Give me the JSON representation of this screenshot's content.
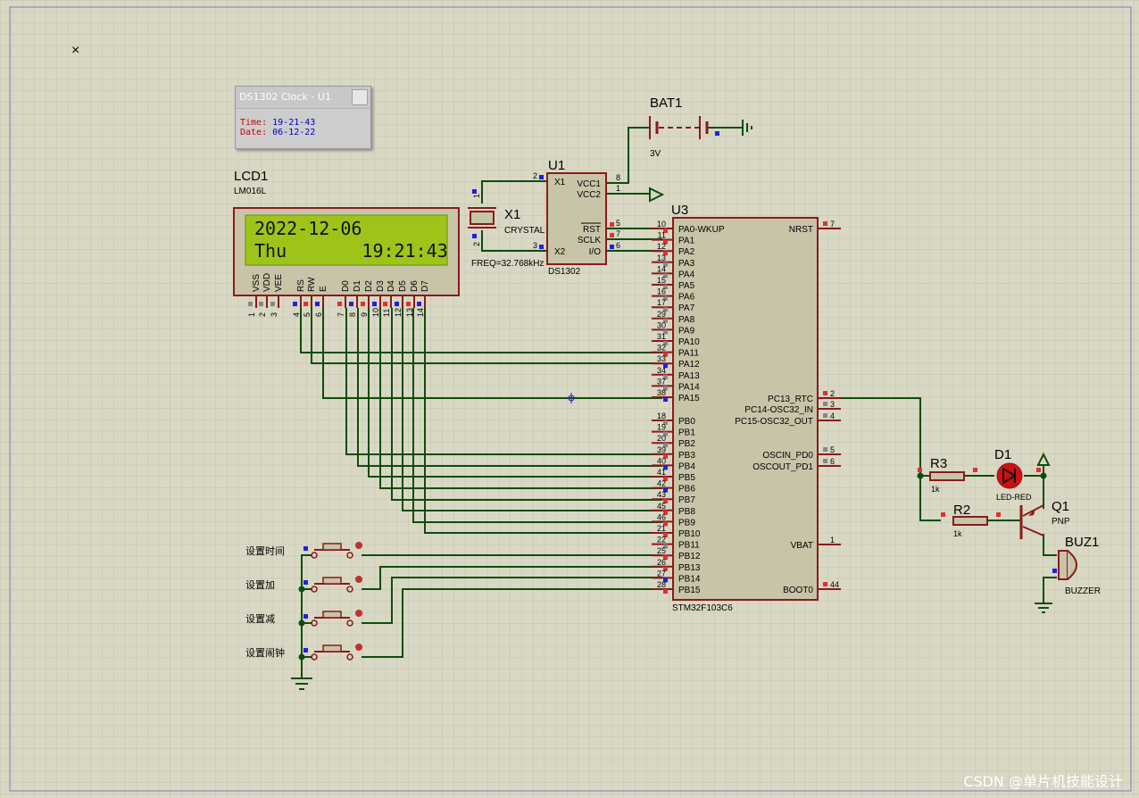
{
  "close_glyph": "×",
  "popup": {
    "title": "DS1302 Clock - U1",
    "time_label": "Time:",
    "time_value": "19-21-43",
    "date_label": "Date:",
    "date_value": "06-12-22"
  },
  "lcd": {
    "ref": "LCD1",
    "model": "LM016L",
    "line1": "2022-12-06",
    "line2": "Thu       19:21:43",
    "pin_names": [
      "VSS",
      "VDD",
      "VEE",
      "RS",
      "RW",
      "E",
      "D0",
      "D1",
      "D2",
      "D3",
      "D4",
      "D5",
      "D6",
      "D7"
    ],
    "pin_numbers": [
      "1",
      "2",
      "3",
      "4",
      "5",
      "6",
      "7",
      "8",
      "9",
      "10",
      "11",
      "12",
      "13",
      "14"
    ]
  },
  "u1": {
    "ref": "U1",
    "model": "DS1302",
    "left_pins": [
      {
        "name": "X1",
        "num": "2"
      },
      {
        "name": "X2",
        "num": "3"
      }
    ],
    "right_pins": [
      {
        "name": "VCC1",
        "num": "8"
      },
      {
        "name": "VCC2",
        "num": "1"
      },
      {
        "name": "RST",
        "num": "5"
      },
      {
        "name": "SCLK",
        "num": "7"
      },
      {
        "name": "I/O",
        "num": "6"
      }
    ]
  },
  "crystal": {
    "ref": "X1",
    "type": "CRYSTAL",
    "freq": "FREQ=32.768kHz",
    "pin1": "1",
    "pin2": "2"
  },
  "battery": {
    "ref": "BAT1",
    "value": "3V"
  },
  "u3": {
    "ref": "U3",
    "model": "STM32F103C6",
    "left_pins": [
      {
        "name": "PA0-WKUP",
        "num": "10"
      },
      {
        "name": "PA1",
        "num": "11"
      },
      {
        "name": "PA2",
        "num": "12"
      },
      {
        "name": "PA3",
        "num": "13"
      },
      {
        "name": "PA4",
        "num": "14"
      },
      {
        "name": "PA5",
        "num": "15"
      },
      {
        "name": "PA6",
        "num": "16"
      },
      {
        "name": "PA7",
        "num": "17"
      },
      {
        "name": "PA8",
        "num": "29"
      },
      {
        "name": "PA9",
        "num": "30"
      },
      {
        "name": "PA10",
        "num": "31"
      },
      {
        "name": "PA11",
        "num": "32"
      },
      {
        "name": "PA12",
        "num": "33"
      },
      {
        "name": "PA13",
        "num": "34"
      },
      {
        "name": "PA14",
        "num": "37"
      },
      {
        "name": "PA15",
        "num": "38"
      },
      {
        "name": "PB0",
        "num": "18"
      },
      {
        "name": "PB1",
        "num": "19"
      },
      {
        "name": "PB2",
        "num": "20"
      },
      {
        "name": "PB3",
        "num": "39"
      },
      {
        "name": "PB4",
        "num": "40"
      },
      {
        "name": "PB5",
        "num": "41"
      },
      {
        "name": "PB6",
        "num": "42"
      },
      {
        "name": "PB7",
        "num": "43"
      },
      {
        "name": "PB8",
        "num": "45"
      },
      {
        "name": "PB9",
        "num": "46"
      },
      {
        "name": "PB10",
        "num": "21"
      },
      {
        "name": "PB11",
        "num": "22"
      },
      {
        "name": "PB12",
        "num": "25"
      },
      {
        "name": "PB13",
        "num": "26"
      },
      {
        "name": "PB14",
        "num": "27"
      },
      {
        "name": "PB15",
        "num": "28"
      }
    ],
    "right_pins": [
      {
        "name": "NRST",
        "num": "7"
      },
      {
        "name": "PC13_RTC",
        "num": "2"
      },
      {
        "name": "PC14-OSC32_IN",
        "num": "3"
      },
      {
        "name": "PC15-OSC32_OUT",
        "num": "4"
      },
      {
        "name": "OSCIN_PD0",
        "num": "5"
      },
      {
        "name": "OSCOUT_PD1",
        "num": "6"
      },
      {
        "name": "VBAT",
        "num": "1"
      },
      {
        "name": "BOOT0",
        "num": "44"
      }
    ]
  },
  "r3": {
    "ref": "R3",
    "value": "1k"
  },
  "r2": {
    "ref": "R2",
    "value": "1k"
  },
  "d1": {
    "ref": "D1",
    "type": "LED-RED"
  },
  "q1": {
    "ref": "Q1",
    "type": "PNP"
  },
  "buz1": {
    "ref": "BUZ1",
    "type": "BUZZER"
  },
  "buttons": [
    "设置时间",
    "设置加",
    "设置减",
    "设置闹钟"
  ],
  "watermark": "CSDN @单片机技能设计",
  "colors": {
    "background": "#d8d8c4",
    "grid": "#c4c4ae",
    "wire": "#0d4d0d",
    "body_fill": "#c8c4a8",
    "body_stroke": "#8b1a1a",
    "lcd_screen": "#9ec41a",
    "pin_red": "#e03030",
    "pin_blue": "#2020e0"
  }
}
